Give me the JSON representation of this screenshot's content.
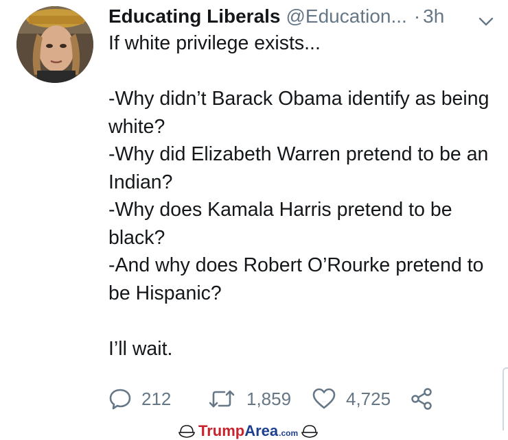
{
  "tweet": {
    "author_name": "Educating Liberals",
    "handle": "@Education...",
    "separator": "·",
    "time": "3h",
    "text": "If white privilege exists...\n\n-Why didn’t Barack Obama identify as being white?\n-Why did Elizabeth Warren pretend to be an Indian?\n-Why does Kamala Harris pretend to be black?\n-And why does Robert O’Rourke pretend to be Hispanic?\n\nI’ll wait."
  },
  "actions": {
    "replies": "212",
    "retweets": "1,859",
    "likes": "4,725"
  },
  "watermark": {
    "part1": "Trump",
    "part2": "Area",
    "part3": ".com"
  },
  "icons": {
    "reply": "reply-icon",
    "retweet": "retweet-icon",
    "like": "heart-icon",
    "share": "share-icon",
    "menu": "chevron-down-icon"
  },
  "colors": {
    "text": "#14171a",
    "secondary": "#657786",
    "watermark_red": "#c8232c",
    "watermark_blue": "#1c3f8f"
  }
}
